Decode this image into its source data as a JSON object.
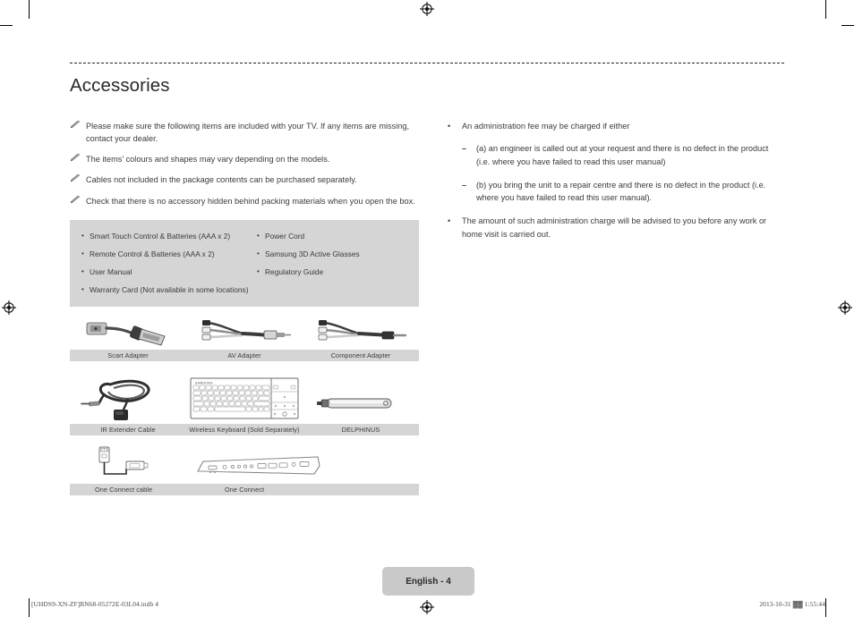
{
  "document": {
    "title": "Accessories",
    "page_badge": "English - 4",
    "footer_left": "[UHDS9-XN-ZF]BN68-05272E-03L04.indb   4",
    "footer_right": "2013-10-31   ▓▓ 1:55:44"
  },
  "notes": [
    {
      "icon": "pencil-note-icon",
      "text": "Please make sure the following items are included with your TV. If any items are missing, contact your dealer."
    },
    {
      "icon": "pencil-note-icon",
      "text": "The items’ colours and shapes may vary depending on the models."
    },
    {
      "icon": "pencil-note-icon",
      "text": "Cables not included in the package contents can be purchased separately."
    },
    {
      "icon": "pencil-note-icon",
      "text": "Check that there is no accessory hidden behind packing materials when you open the box."
    }
  ],
  "right_column": {
    "bullets": [
      {
        "mark": "•",
        "text": "An administration fee may be charged if either",
        "sub": [
          {
            "mark": "–",
            "text": "(a) an engineer is called out at your request and there is no defect in the product (i.e. where you have failed to read this user manual)"
          },
          {
            "mark": "–",
            "text": "(b) you bring the unit to a repair centre and there is no defect in the product (i.e. where you have failed to read this user manual)."
          }
        ]
      },
      {
        "mark": "•",
        "text": "The amount of such administration charge will be advised to you before any work or home visit is carried out.",
        "sub": []
      }
    ]
  },
  "contents_box": {
    "bullet": "•",
    "column1": [
      "Smart Touch Control & Batteries (AAA x 2)",
      "Remote Control & Batteries (AAA x 2)",
      "User Manual"
    ],
    "column2": [
      "Power Cord",
      "Samsung 3D Active Glasses",
      "Regulatory Guide"
    ],
    "full_width": [
      "Warranty Card (Not available in some locations)"
    ]
  },
  "accessory_rows": [
    {
      "row_id": "adapters",
      "captions": [
        "Scart Adapter",
        "AV Adapter",
        "Component Adapter"
      ],
      "figures": [
        "scart-adapter-image",
        "av-adapter-image",
        "component-adapter-image"
      ]
    },
    {
      "row_id": "peripherals",
      "captions": [
        "IR Extender Cable",
        "Wireless Keyboard (Sold Separately)",
        "DELPHINUS"
      ],
      "figures": [
        "ir-extender-cable-image",
        "wireless-keyboard-image",
        "delphinus-image"
      ]
    },
    {
      "row_id": "one-connect",
      "captions": [
        "One Connect cable",
        "One Connect"
      ],
      "figures": [
        "one-connect-cable-image",
        "one-connect-box-image"
      ]
    }
  ],
  "colors": {
    "box_gray": "#d5d5d5",
    "badge_gray": "#c9c9c9",
    "text": "#3c3c3c"
  }
}
